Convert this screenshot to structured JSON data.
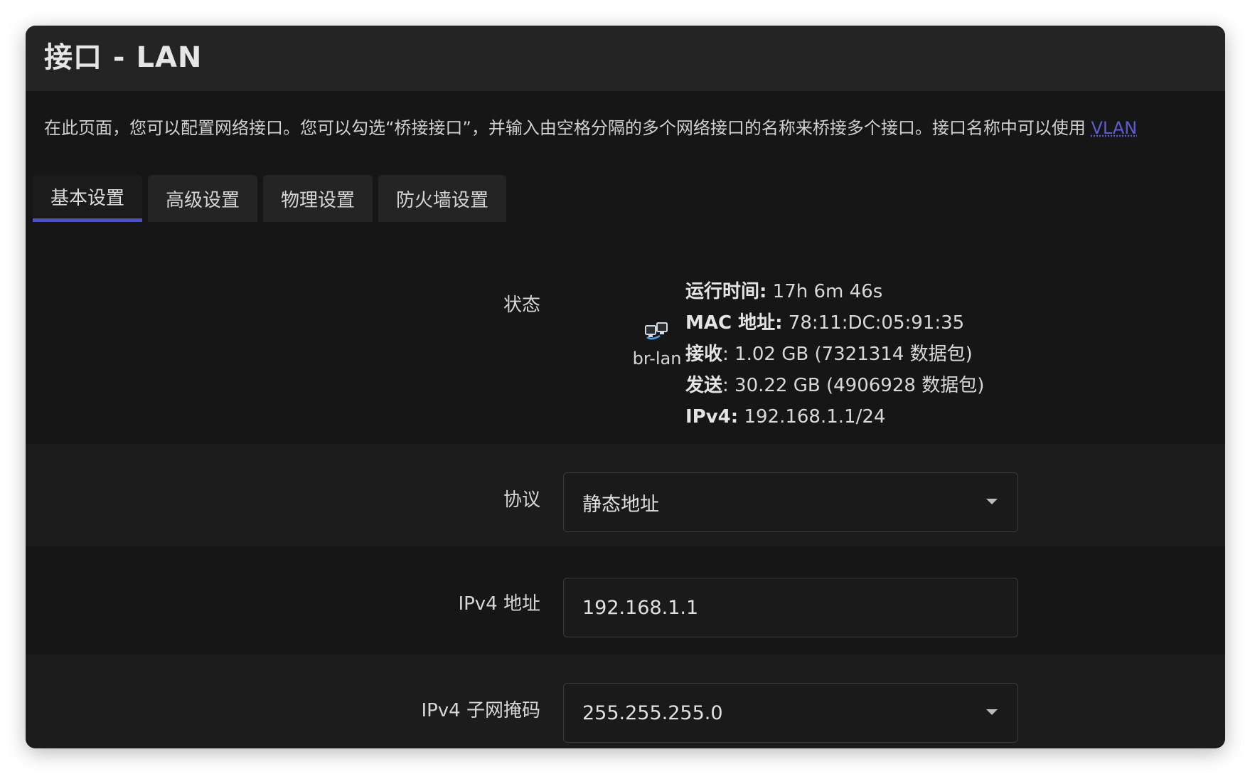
{
  "page": {
    "title": "接口 - LAN",
    "description_text": "在此页面，您可以配置网络接口。您可以勾选“桥接接口”，并输入由空格分隔的多个网络接口的名称来桥接多个接口。接口名称中可以使用 ",
    "description_link": "VLAN"
  },
  "tabs": [
    {
      "label": "基本设置",
      "active": true
    },
    {
      "label": "高级设置",
      "active": false
    },
    {
      "label": "物理设置",
      "active": false
    },
    {
      "label": "防火墙设置",
      "active": false
    }
  ],
  "status": {
    "label": "状态",
    "interface_name": "br-lan",
    "interface_icon": "ethernet-bridge-icon",
    "uptime_key": "运行时间:",
    "uptime_value": " 17h 6m 46s",
    "mac_key": "MAC 地址:",
    "mac_value": " 78:11:DC:05:91:35",
    "rx_key": "接收",
    "rx_value": ": 1.02 GB (7321314 数据包)",
    "tx_key": "发送",
    "tx_value": ": 30.22 GB (4906928 数据包)",
    "ipv4_key": "IPv4:",
    "ipv4_value": " 192.168.1.1/24"
  },
  "fields": {
    "protocol": {
      "label": "协议",
      "value": "静态地址"
    },
    "ipv4_address": {
      "label": "IPv4 地址",
      "value": "192.168.1.1"
    },
    "ipv4_netmask": {
      "label": "IPv4 子网掩码",
      "value": "255.255.255.0"
    }
  },
  "colors": {
    "background": "#161616",
    "header": "#242424",
    "accent": "#4a4fd6",
    "link": "#5b5bd6"
  }
}
